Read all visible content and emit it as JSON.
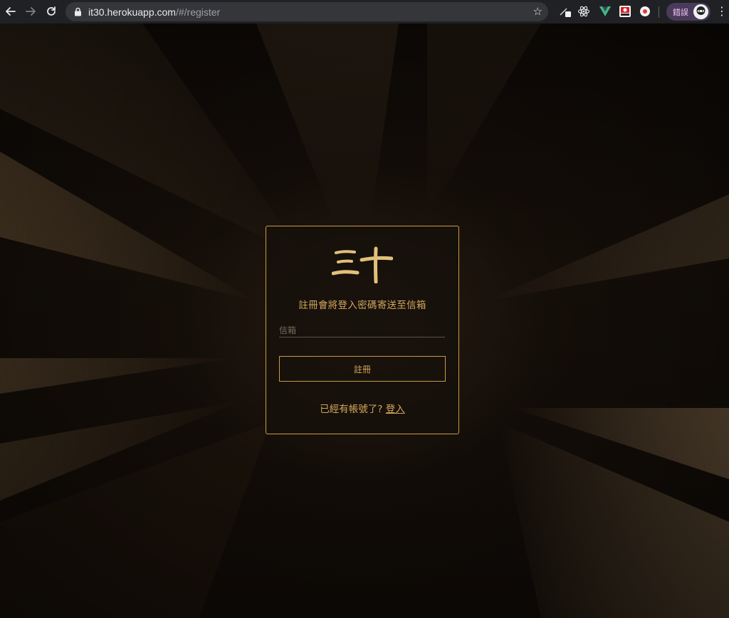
{
  "browser": {
    "url_host": "it30.herokuapp.com",
    "url_path": "/#/register",
    "icons": {
      "back": "arrow-left-icon",
      "forward": "arrow-right-icon",
      "reload": "reload-icon",
      "lock": "lock-icon",
      "bookmark": "star-icon",
      "menu": "kebab-menu-icon"
    },
    "profile_label": "錯誤",
    "colors": {
      "toolbar": "#202124",
      "omnibox": "#35363a",
      "profile_pill": "#4a3b5a"
    }
  },
  "card": {
    "logo_text": "三十",
    "hint": "註冊會將登入密碼寄送至信箱",
    "email_placeholder": "信箱",
    "email_value": "",
    "register_label": "註冊",
    "have_account_text": "已經有帳號了?",
    "login_link": "登入",
    "colors": {
      "accent": "#c99a45",
      "text": "#d2a75a"
    }
  }
}
